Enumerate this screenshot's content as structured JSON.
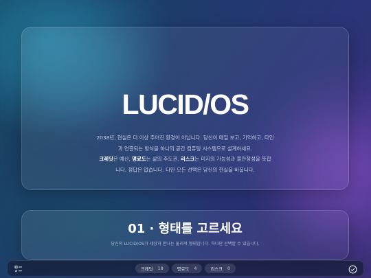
{
  "hero": {
    "title": "LUCID/OS",
    "desc_line1": "2038년, 현실은 더 이상 주어진 환경이 아닙니다. 당신이 매일 보고, 기억하고, 타인",
    "desc_line2": "과 연결되는 방식을 하나의 공간 컴퓨팅 시스템으로 설계하세요.",
    "desc_line3": {
      "term1": "크레딧",
      "text1": "은 예산, ",
      "term2": "명료도",
      "text2": "는 삶의 주도권, ",
      "term3": "리스크",
      "text3": "는 미지의 가능성과 불안정성을 뜻합"
    },
    "desc_line4": "니다. 정답은 없습니다. 다만 모든 선택은 당신의 현실을 바꿉니다."
  },
  "step": {
    "title": "01 · 형태를 고르세요",
    "subtitle": "당신의 LUCID/OS가 세상과 만나는 물리적 형태입니다. 하나만 선택할 수 있습니다."
  },
  "bottombar": {
    "stats": [
      {
        "label": "크레딧",
        "value": "18"
      },
      {
        "label": "명료도",
        "value": "4"
      },
      {
        "label": "리스크",
        "value": "0"
      }
    ],
    "left_icon": "checklist-icon",
    "right_icon": "check-circle-icon"
  }
}
